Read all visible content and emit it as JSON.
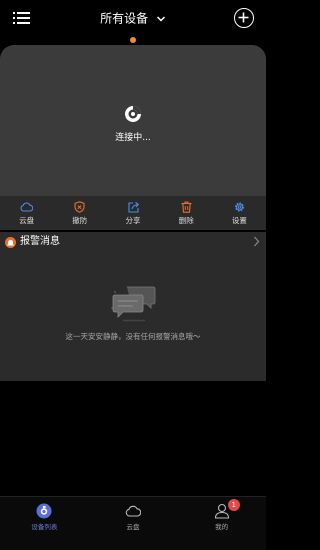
{
  "header": {
    "title": "所有设备",
    "menu_icon": "menu-icon",
    "add_icon": "add-circle-icon"
  },
  "player": {
    "status_text": "连接中..."
  },
  "actions": [
    {
      "label": "云盘",
      "icon": "cloud-icon",
      "color": "#4a8fe7"
    },
    {
      "label": "撤防",
      "icon": "shield-icon",
      "color": "#ee6f2d"
    },
    {
      "label": "分享",
      "icon": "share-icon",
      "color": "#4a8fe7"
    },
    {
      "label": "删除",
      "icon": "trash-icon",
      "color": "#ee6f2d"
    },
    {
      "label": "设置",
      "icon": "gear-icon",
      "color": "#4a8fe7"
    }
  ],
  "alarm": {
    "title": "报警消息",
    "empty_text": "这一天安安静静，没有任何报警消息哦～"
  },
  "tabbar": {
    "items": [
      {
        "label": "设备列表",
        "icon": "device-list-icon",
        "active": true
      },
      {
        "label": "云盘",
        "icon": "cloud-icon",
        "active": false
      },
      {
        "label": "我的",
        "icon": "profile-icon",
        "active": false,
        "badge": "1"
      }
    ]
  },
  "colors": {
    "accent_orange": "#ee6f2d",
    "accent_blue": "#4a8fe7",
    "active_tab": "#6b7fe0",
    "badge_red": "#e24a4a"
  }
}
